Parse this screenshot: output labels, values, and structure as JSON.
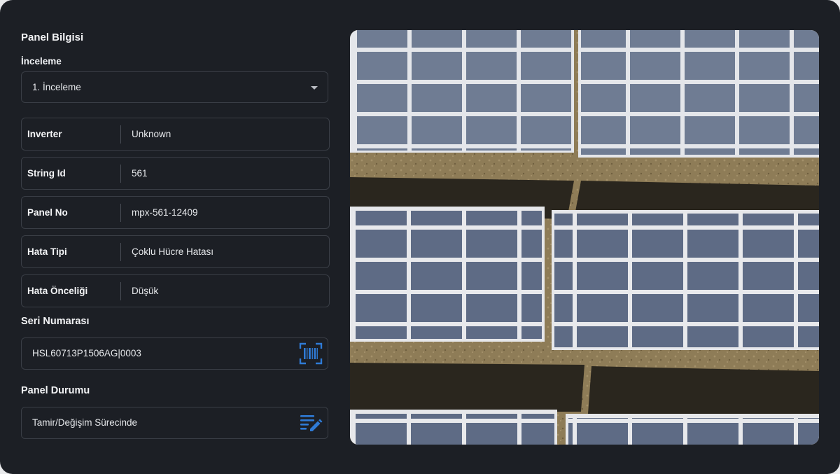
{
  "panel_info_title": "Panel Bilgisi",
  "inspection": {
    "label": "İnceleme",
    "selected": "1. İnceleme"
  },
  "details": [
    {
      "key": "Inverter",
      "value": "Unknown"
    },
    {
      "key": "String Id",
      "value": "561"
    },
    {
      "key": "Panel No",
      "value": "mpx-561-12409"
    },
    {
      "key": "Hata Tipi",
      "value": "Çoklu Hücre Hatası"
    },
    {
      "key": "Hata Önceliği",
      "value": "Düşük"
    }
  ],
  "serial": {
    "label": "Seri Numarası",
    "value": "HSL60713P1506AG|0003",
    "icon": "barcode-scan-icon"
  },
  "status": {
    "label": "Panel Durumu",
    "value": "Tamir/Değişim Sürecinde",
    "icon": "edit-list-icon"
  },
  "photo": {
    "description_icon": "solar-panel-aerial-image"
  },
  "colors": {
    "background": "#1c1f25",
    "border": "#3a3e46",
    "accent": "#2f7bd6",
    "text": "#e6e8eb"
  }
}
